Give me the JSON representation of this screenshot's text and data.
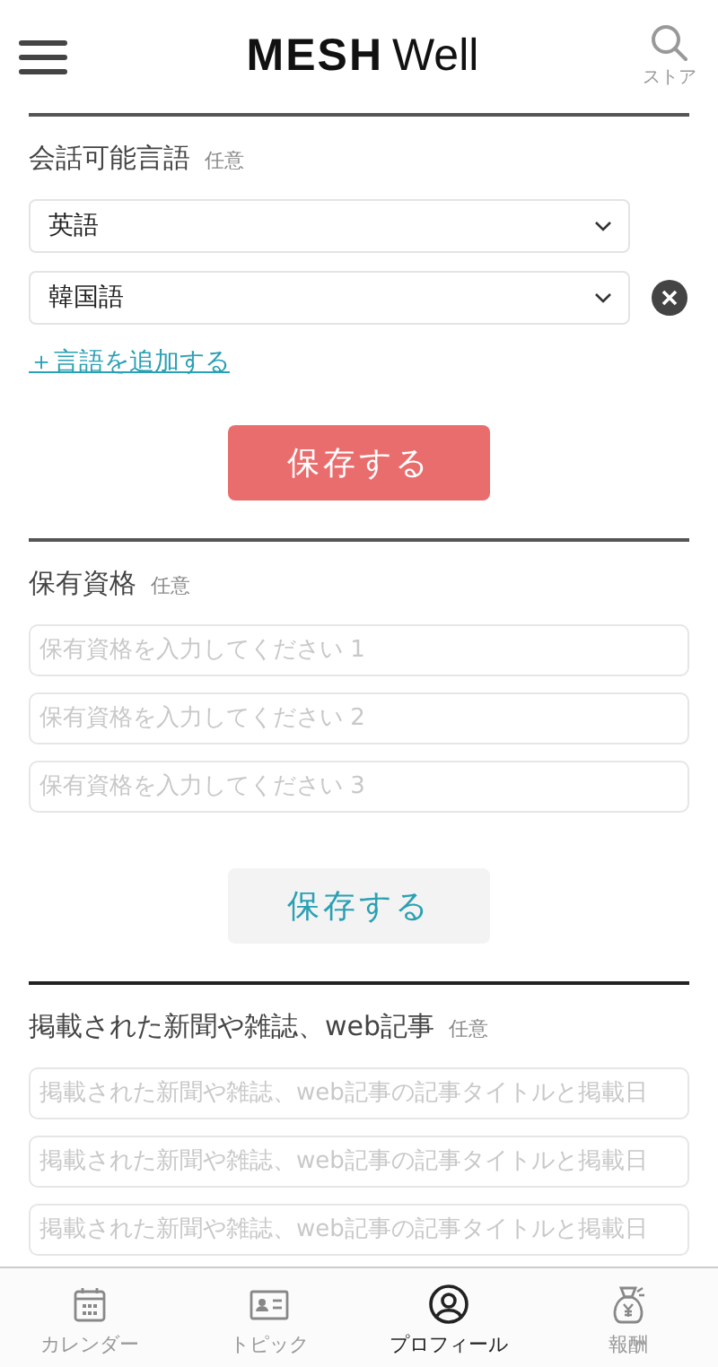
{
  "header": {
    "logo_bold": "MESH",
    "logo_light": "Well",
    "store_label": "ストア"
  },
  "sections": [
    {
      "kind": "languages",
      "title": "会話可能言語",
      "badge": "任意",
      "selects": [
        {
          "value": "英語",
          "removable": false
        },
        {
          "value": "韓国語",
          "removable": true
        }
      ],
      "add_link": "＋言語を追加する",
      "save_button": {
        "label": "保存する",
        "active": true
      }
    },
    {
      "kind": "inputs",
      "title": "保有資格",
      "badge": "任意",
      "fields": [
        {
          "placeholder": "保有資格を入力してください 1"
        },
        {
          "placeholder": "保有資格を入力してください 2"
        },
        {
          "placeholder": "保有資格を入力してください 3"
        }
      ],
      "save_button": {
        "label": "保存する",
        "active": false
      }
    },
    {
      "kind": "inputs",
      "title": "掲載された新聞や雑誌、web記事",
      "badge": "任意",
      "fields": [
        {
          "placeholder": "掲載された新聞や雑誌、web記事の記事タイトルと掲載日"
        },
        {
          "placeholder": "掲載された新聞や雑誌、web記事の記事タイトルと掲載日"
        },
        {
          "placeholder": "掲載された新聞や雑誌、web記事の記事タイトルと掲載日"
        }
      ]
    }
  ],
  "bottom_nav": [
    {
      "kind": "calendar",
      "label": "カレンダー",
      "selected": false
    },
    {
      "kind": "topic",
      "label": "トピック",
      "selected": false
    },
    {
      "kind": "profile",
      "label": "プロフィール",
      "selected": true
    },
    {
      "kind": "reward",
      "label": "報酬",
      "selected": false
    }
  ]
}
